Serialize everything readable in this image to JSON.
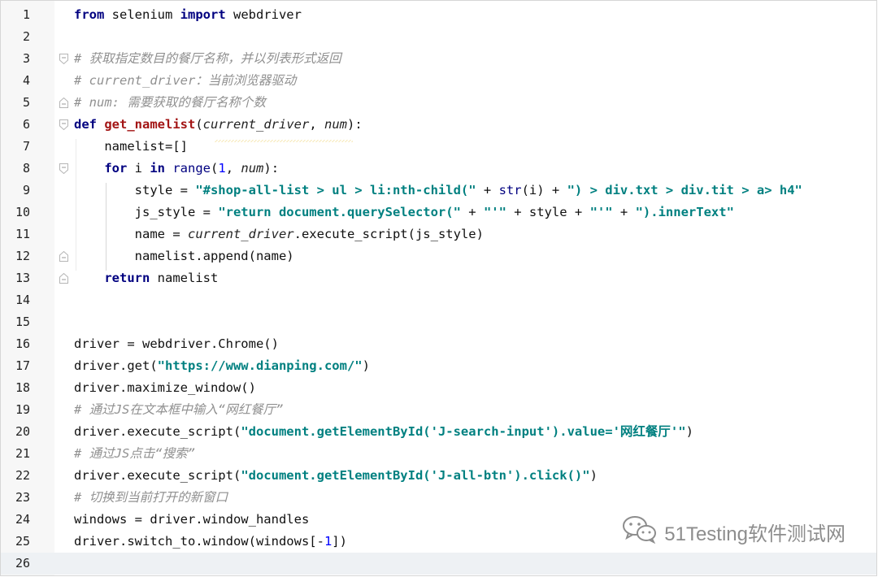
{
  "editor": {
    "current_line": 26,
    "lines": [
      {
        "n": "1",
        "tokens": [
          [
            "kw",
            "from"
          ],
          [
            "t",
            " selenium "
          ],
          [
            "kw",
            "import"
          ],
          [
            "t",
            " webdriver"
          ]
        ]
      },
      {
        "n": "2",
        "tokens": []
      },
      {
        "n": "3",
        "tokens": [
          [
            "cm",
            "# 获取指定数目的餐厅名称，并以列表形式返回"
          ]
        ]
      },
      {
        "n": "4",
        "tokens": [
          [
            "cm",
            "# current_driver：当前浏览器驱动"
          ]
        ]
      },
      {
        "n": "5",
        "tokens": [
          [
            "cm",
            "# num: 需要获取的餐厅名称个数"
          ]
        ]
      },
      {
        "n": "6",
        "tokens": [
          [
            "kw",
            "def"
          ],
          [
            "t",
            " "
          ],
          [
            "fn",
            "get_namelist"
          ],
          [
            "t",
            "("
          ],
          [
            "param",
            "current_driver"
          ],
          [
            "t",
            ", "
          ],
          [
            "param",
            "num"
          ],
          [
            "t",
            "):"
          ]
        ]
      },
      {
        "n": "7",
        "tokens": [
          [
            "t",
            "    namelist=[]"
          ]
        ]
      },
      {
        "n": "8",
        "tokens": [
          [
            "t",
            "    "
          ],
          [
            "kw",
            "for"
          ],
          [
            "t",
            " i "
          ],
          [
            "kw",
            "in"
          ],
          [
            "t",
            " "
          ],
          [
            "bi",
            "range"
          ],
          [
            "t",
            "("
          ],
          [
            "num",
            "1"
          ],
          [
            "t",
            ", "
          ],
          [
            "param",
            "num"
          ],
          [
            "t",
            "):"
          ]
        ]
      },
      {
        "n": "9",
        "tokens": [
          [
            "t",
            "        style = "
          ],
          [
            "str",
            "\"#shop-all-list > ul > li:nth-child(\""
          ],
          [
            "t",
            " + "
          ],
          [
            "bi",
            "str"
          ],
          [
            "t",
            "(i) + "
          ],
          [
            "str",
            "\") > div.txt > div.tit > a> h4\""
          ]
        ]
      },
      {
        "n": "10",
        "tokens": [
          [
            "t",
            "        js_style = "
          ],
          [
            "str",
            "\"return document.querySelector(\""
          ],
          [
            "t",
            " + "
          ],
          [
            "str",
            "\"'\""
          ],
          [
            "t",
            " + style + "
          ],
          [
            "str",
            "\"'\""
          ],
          [
            "t",
            " + "
          ],
          [
            "str",
            "\").innerText\""
          ]
        ]
      },
      {
        "n": "11",
        "tokens": [
          [
            "t",
            "        name = "
          ],
          [
            "param",
            "current_driver"
          ],
          [
            "t",
            ".execute_script(js_style)"
          ]
        ]
      },
      {
        "n": "12",
        "tokens": [
          [
            "t",
            "        namelist.append(name)"
          ]
        ]
      },
      {
        "n": "13",
        "tokens": [
          [
            "t",
            "    "
          ],
          [
            "kw",
            "return"
          ],
          [
            "t",
            " namelist"
          ]
        ]
      },
      {
        "n": "14",
        "tokens": []
      },
      {
        "n": "15",
        "tokens": []
      },
      {
        "n": "16",
        "tokens": [
          [
            "t",
            "driver = webdriver.Chrome()"
          ]
        ]
      },
      {
        "n": "17",
        "tokens": [
          [
            "t",
            "driver.get("
          ],
          [
            "str",
            "\"https://www.dianping.com/\""
          ],
          [
            "t",
            ")"
          ]
        ]
      },
      {
        "n": "18",
        "tokens": [
          [
            "t",
            "driver.maximize_window()"
          ]
        ]
      },
      {
        "n": "19",
        "tokens": [
          [
            "cm",
            "# 通过JS在文本框中输入“网红餐厅”"
          ]
        ]
      },
      {
        "n": "20",
        "tokens": [
          [
            "t",
            "driver.execute_script("
          ],
          [
            "str",
            "\"document.getElementById('J-search-input').value='网红餐厅'\""
          ],
          [
            "t",
            ")"
          ]
        ]
      },
      {
        "n": "21",
        "tokens": [
          [
            "cm",
            "# 通过JS点击“搜索”"
          ]
        ]
      },
      {
        "n": "22",
        "tokens": [
          [
            "t",
            "driver.execute_script("
          ],
          [
            "str",
            "\"document.getElementById('J-all-btn').click()\""
          ],
          [
            "t",
            ")"
          ]
        ]
      },
      {
        "n": "23",
        "tokens": [
          [
            "cm",
            "# 切换到当前打开的新窗口"
          ]
        ]
      },
      {
        "n": "24",
        "tokens": [
          [
            "t",
            "windows = driver.window_handles"
          ]
        ]
      },
      {
        "n": "25",
        "tokens": [
          [
            "t",
            "driver.switch_to.window(windows[-"
          ],
          [
            "num",
            "1"
          ],
          [
            "t",
            "])"
          ]
        ]
      },
      {
        "n": "26",
        "tokens": []
      }
    ],
    "fold_markers": [
      {
        "line": 3,
        "type": "open"
      },
      {
        "line": 5,
        "type": "close"
      },
      {
        "line": 6,
        "type": "open"
      },
      {
        "line": 8,
        "type": "open"
      },
      {
        "line": 12,
        "type": "close"
      },
      {
        "line": 13,
        "type": "close"
      }
    ]
  },
  "watermark": {
    "text": "51Testing软件测试网",
    "icon": "wechat-icon",
    "color": "#8d8d8d"
  }
}
